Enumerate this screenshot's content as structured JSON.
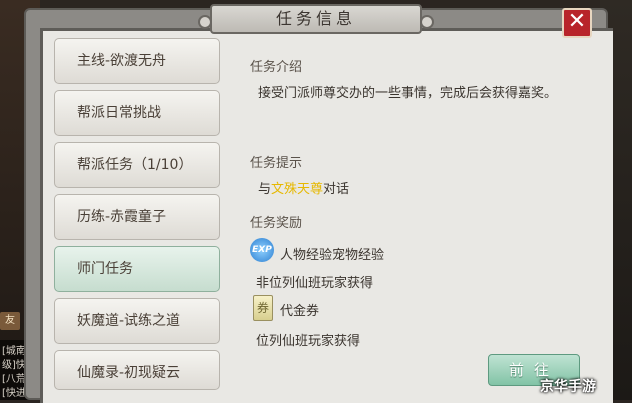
{
  "window": {
    "title": "任务信息",
    "close_label": "✕"
  },
  "task_list": [
    {
      "label": "主线-欲渡无舟"
    },
    {
      "label": "帮派日常挑战"
    },
    {
      "label": "帮派任务（1/10）"
    },
    {
      "label": "历练-赤霞童子"
    },
    {
      "label": "师门任务",
      "selected": true
    },
    {
      "label": "妖魔道-试练之道"
    },
    {
      "label": "仙魔录-初现疑云"
    }
  ],
  "detail": {
    "intro_title": "任务介绍",
    "intro_text": "接受门派师尊交办的一些事情，完成后会获得嘉奖。",
    "hint_title": "任务提示",
    "hint_prefix": "与",
    "hint_npc": "文殊天尊",
    "hint_suffix": "对话",
    "reward_title": "任务奖励",
    "rewards": [
      {
        "icon": "EXP",
        "text": "人物经验宠物经验",
        "condition": "非位列仙班玩家获得"
      },
      {
        "icon": "券",
        "text": "代金券",
        "condition": "位列仙班玩家获得"
      }
    ],
    "go_label": "前往"
  },
  "background": {
    "badge": "友",
    "chat": [
      "[城南",
      "级]快进",
      "[八荒",
      "[快进"
    ]
  },
  "watermark": "京华手游",
  "colors": {
    "accent_npc": "#e6b800",
    "close": "#b8242a",
    "go": "#82c3a6"
  }
}
